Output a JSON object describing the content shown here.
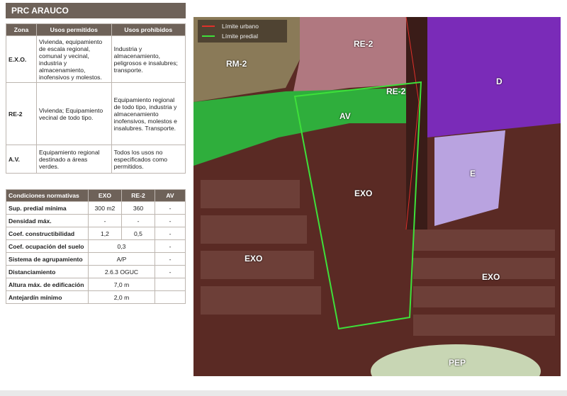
{
  "title": "PRC ARAUCO",
  "zones_table": {
    "headers": [
      "Zona",
      "Usos permitidos",
      "Usos prohibidos"
    ],
    "rows": [
      {
        "zona": "E.X.O.",
        "permitidos": "Vivienda, equipamiento de escala regional, comunal y vecinal, industria y almacenamiento, inofensivos y molestos.",
        "prohibidos": "Industria y almacenamiento, peligrosos e insalubres; transporte."
      },
      {
        "zona": "RE-2",
        "permitidos": "Vivienda; Equipamiento vecinal de todo tipo.",
        "prohibidos": "Equipamiento regional de todo tipo, industria y almacenamiento inofensivos, molestos e insalubres. Transporte."
      },
      {
        "zona": "A.V.",
        "permitidos": "Equipamiento regional destinado a áreas verdes.",
        "prohibidos": "Todos los usos no especificados como permitidos."
      }
    ]
  },
  "norms_table": {
    "headers": [
      "Condiciones normativas",
      "EXO",
      "RE-2",
      "AV"
    ],
    "rows": [
      {
        "label": "Sup. predial mínima",
        "exo": "300 m2",
        "re2": "360",
        "av": "-"
      },
      {
        "label": "Densidad máx.",
        "exo": "-",
        "re2": "-",
        "av": "-"
      },
      {
        "label": "Coef. constructibilidad",
        "exo": "1,2",
        "re2": "0,5",
        "av": "-"
      },
      {
        "label": "Coef. ocupación del suelo",
        "merged": "0,3",
        "av": "-"
      },
      {
        "label": "Sistema de agrupamiento",
        "merged": "A/P",
        "av": "-"
      },
      {
        "label": "Distanciamiento",
        "merged": "2.6.3 OGUC",
        "av": "-"
      },
      {
        "label": "Altura máx. de edificación",
        "merged": "7,0 m",
        "av": ""
      },
      {
        "label": "Antejardín mínimo",
        "merged": "2,0 m",
        "av": ""
      }
    ]
  },
  "map": {
    "legend": [
      {
        "label": "Límite urbano",
        "color": "#e0302a"
      },
      {
        "label": "Límite predial",
        "color": "#3ee03a"
      }
    ],
    "zone_labels": [
      "RM-2",
      "RE-2",
      "RE-2",
      "AV",
      "D",
      "E",
      "EXO",
      "EXO",
      "EXO",
      "PEP"
    ],
    "colors": {
      "exo": "#5a2a24",
      "av": "#2fae3c",
      "d": "#7a2bb8",
      "e": "#c8b8ee",
      "re2": "#d89aa3",
      "rm2": "#c9b896",
      "pep": "#c8d6b4"
    }
  }
}
